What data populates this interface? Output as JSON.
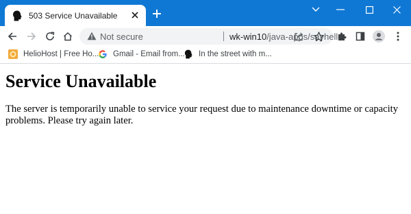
{
  "tab": {
    "title": "503 Service Unavailable"
  },
  "omnibox": {
    "security_label": "Not secure",
    "url_host": "wk-win10",
    "url_path": "/java-apps/sayhello"
  },
  "bookmarks": [
    {
      "label": "HelioHost | Free Ho...",
      "icon": "heliohost-icon"
    },
    {
      "label": "Gmail - Email from...",
      "icon": "google-g-icon"
    },
    {
      "label": "In the street with m...",
      "icon": "head-silhouette-icon"
    }
  ],
  "page": {
    "heading": "Service Unavailable",
    "message": "The server is temporarily unable to service your request due to maintenance downtime or capacity problems. Please try again later."
  },
  "colors": {
    "titlebar": "#0f78d4",
    "omnibox_bg": "#f1f3f4",
    "text_dark": "#202124",
    "text_muted": "#5f6368"
  }
}
